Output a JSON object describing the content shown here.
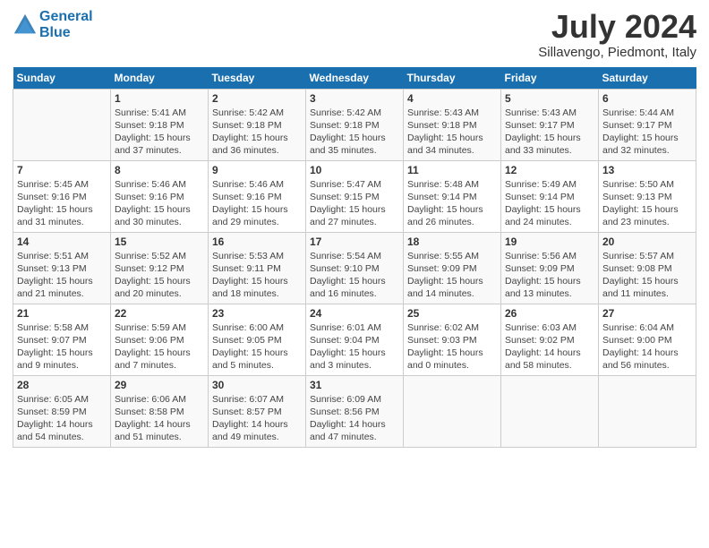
{
  "header": {
    "logo_line1": "General",
    "logo_line2": "Blue",
    "title": "July 2024",
    "subtitle": "Sillavengo, Piedmont, Italy"
  },
  "calendar": {
    "days_of_week": [
      "Sunday",
      "Monday",
      "Tuesday",
      "Wednesday",
      "Thursday",
      "Friday",
      "Saturday"
    ],
    "weeks": [
      [
        {
          "date": "",
          "info": ""
        },
        {
          "date": "1",
          "info": "Sunrise: 5:41 AM\nSunset: 9:18 PM\nDaylight: 15 hours\nand 37 minutes."
        },
        {
          "date": "2",
          "info": "Sunrise: 5:42 AM\nSunset: 9:18 PM\nDaylight: 15 hours\nand 36 minutes."
        },
        {
          "date": "3",
          "info": "Sunrise: 5:42 AM\nSunset: 9:18 PM\nDaylight: 15 hours\nand 35 minutes."
        },
        {
          "date": "4",
          "info": "Sunrise: 5:43 AM\nSunset: 9:18 PM\nDaylight: 15 hours\nand 34 minutes."
        },
        {
          "date": "5",
          "info": "Sunrise: 5:43 AM\nSunset: 9:17 PM\nDaylight: 15 hours\nand 33 minutes."
        },
        {
          "date": "6",
          "info": "Sunrise: 5:44 AM\nSunset: 9:17 PM\nDaylight: 15 hours\nand 32 minutes."
        }
      ],
      [
        {
          "date": "7",
          "info": "Sunrise: 5:45 AM\nSunset: 9:16 PM\nDaylight: 15 hours\nand 31 minutes."
        },
        {
          "date": "8",
          "info": "Sunrise: 5:46 AM\nSunset: 9:16 PM\nDaylight: 15 hours\nand 30 minutes."
        },
        {
          "date": "9",
          "info": "Sunrise: 5:46 AM\nSunset: 9:16 PM\nDaylight: 15 hours\nand 29 minutes."
        },
        {
          "date": "10",
          "info": "Sunrise: 5:47 AM\nSunset: 9:15 PM\nDaylight: 15 hours\nand 27 minutes."
        },
        {
          "date": "11",
          "info": "Sunrise: 5:48 AM\nSunset: 9:14 PM\nDaylight: 15 hours\nand 26 minutes."
        },
        {
          "date": "12",
          "info": "Sunrise: 5:49 AM\nSunset: 9:14 PM\nDaylight: 15 hours\nand 24 minutes."
        },
        {
          "date": "13",
          "info": "Sunrise: 5:50 AM\nSunset: 9:13 PM\nDaylight: 15 hours\nand 23 minutes."
        }
      ],
      [
        {
          "date": "14",
          "info": "Sunrise: 5:51 AM\nSunset: 9:13 PM\nDaylight: 15 hours\nand 21 minutes."
        },
        {
          "date": "15",
          "info": "Sunrise: 5:52 AM\nSunset: 9:12 PM\nDaylight: 15 hours\nand 20 minutes."
        },
        {
          "date": "16",
          "info": "Sunrise: 5:53 AM\nSunset: 9:11 PM\nDaylight: 15 hours\nand 18 minutes."
        },
        {
          "date": "17",
          "info": "Sunrise: 5:54 AM\nSunset: 9:10 PM\nDaylight: 15 hours\nand 16 minutes."
        },
        {
          "date": "18",
          "info": "Sunrise: 5:55 AM\nSunset: 9:09 PM\nDaylight: 15 hours\nand 14 minutes."
        },
        {
          "date": "19",
          "info": "Sunrise: 5:56 AM\nSunset: 9:09 PM\nDaylight: 15 hours\nand 13 minutes."
        },
        {
          "date": "20",
          "info": "Sunrise: 5:57 AM\nSunset: 9:08 PM\nDaylight: 15 hours\nand 11 minutes."
        }
      ],
      [
        {
          "date": "21",
          "info": "Sunrise: 5:58 AM\nSunset: 9:07 PM\nDaylight: 15 hours\nand 9 minutes."
        },
        {
          "date": "22",
          "info": "Sunrise: 5:59 AM\nSunset: 9:06 PM\nDaylight: 15 hours\nand 7 minutes."
        },
        {
          "date": "23",
          "info": "Sunrise: 6:00 AM\nSunset: 9:05 PM\nDaylight: 15 hours\nand 5 minutes."
        },
        {
          "date": "24",
          "info": "Sunrise: 6:01 AM\nSunset: 9:04 PM\nDaylight: 15 hours\nand 3 minutes."
        },
        {
          "date": "25",
          "info": "Sunrise: 6:02 AM\nSunset: 9:03 PM\nDaylight: 15 hours\nand 0 minutes."
        },
        {
          "date": "26",
          "info": "Sunrise: 6:03 AM\nSunset: 9:02 PM\nDaylight: 14 hours\nand 58 minutes."
        },
        {
          "date": "27",
          "info": "Sunrise: 6:04 AM\nSunset: 9:00 PM\nDaylight: 14 hours\nand 56 minutes."
        }
      ],
      [
        {
          "date": "28",
          "info": "Sunrise: 6:05 AM\nSunset: 8:59 PM\nDaylight: 14 hours\nand 54 minutes."
        },
        {
          "date": "29",
          "info": "Sunrise: 6:06 AM\nSunset: 8:58 PM\nDaylight: 14 hours\nand 51 minutes."
        },
        {
          "date": "30",
          "info": "Sunrise: 6:07 AM\nSunset: 8:57 PM\nDaylight: 14 hours\nand 49 minutes."
        },
        {
          "date": "31",
          "info": "Sunrise: 6:09 AM\nSunset: 8:56 PM\nDaylight: 14 hours\nand 47 minutes."
        },
        {
          "date": "",
          "info": ""
        },
        {
          "date": "",
          "info": ""
        },
        {
          "date": "",
          "info": ""
        }
      ]
    ]
  }
}
